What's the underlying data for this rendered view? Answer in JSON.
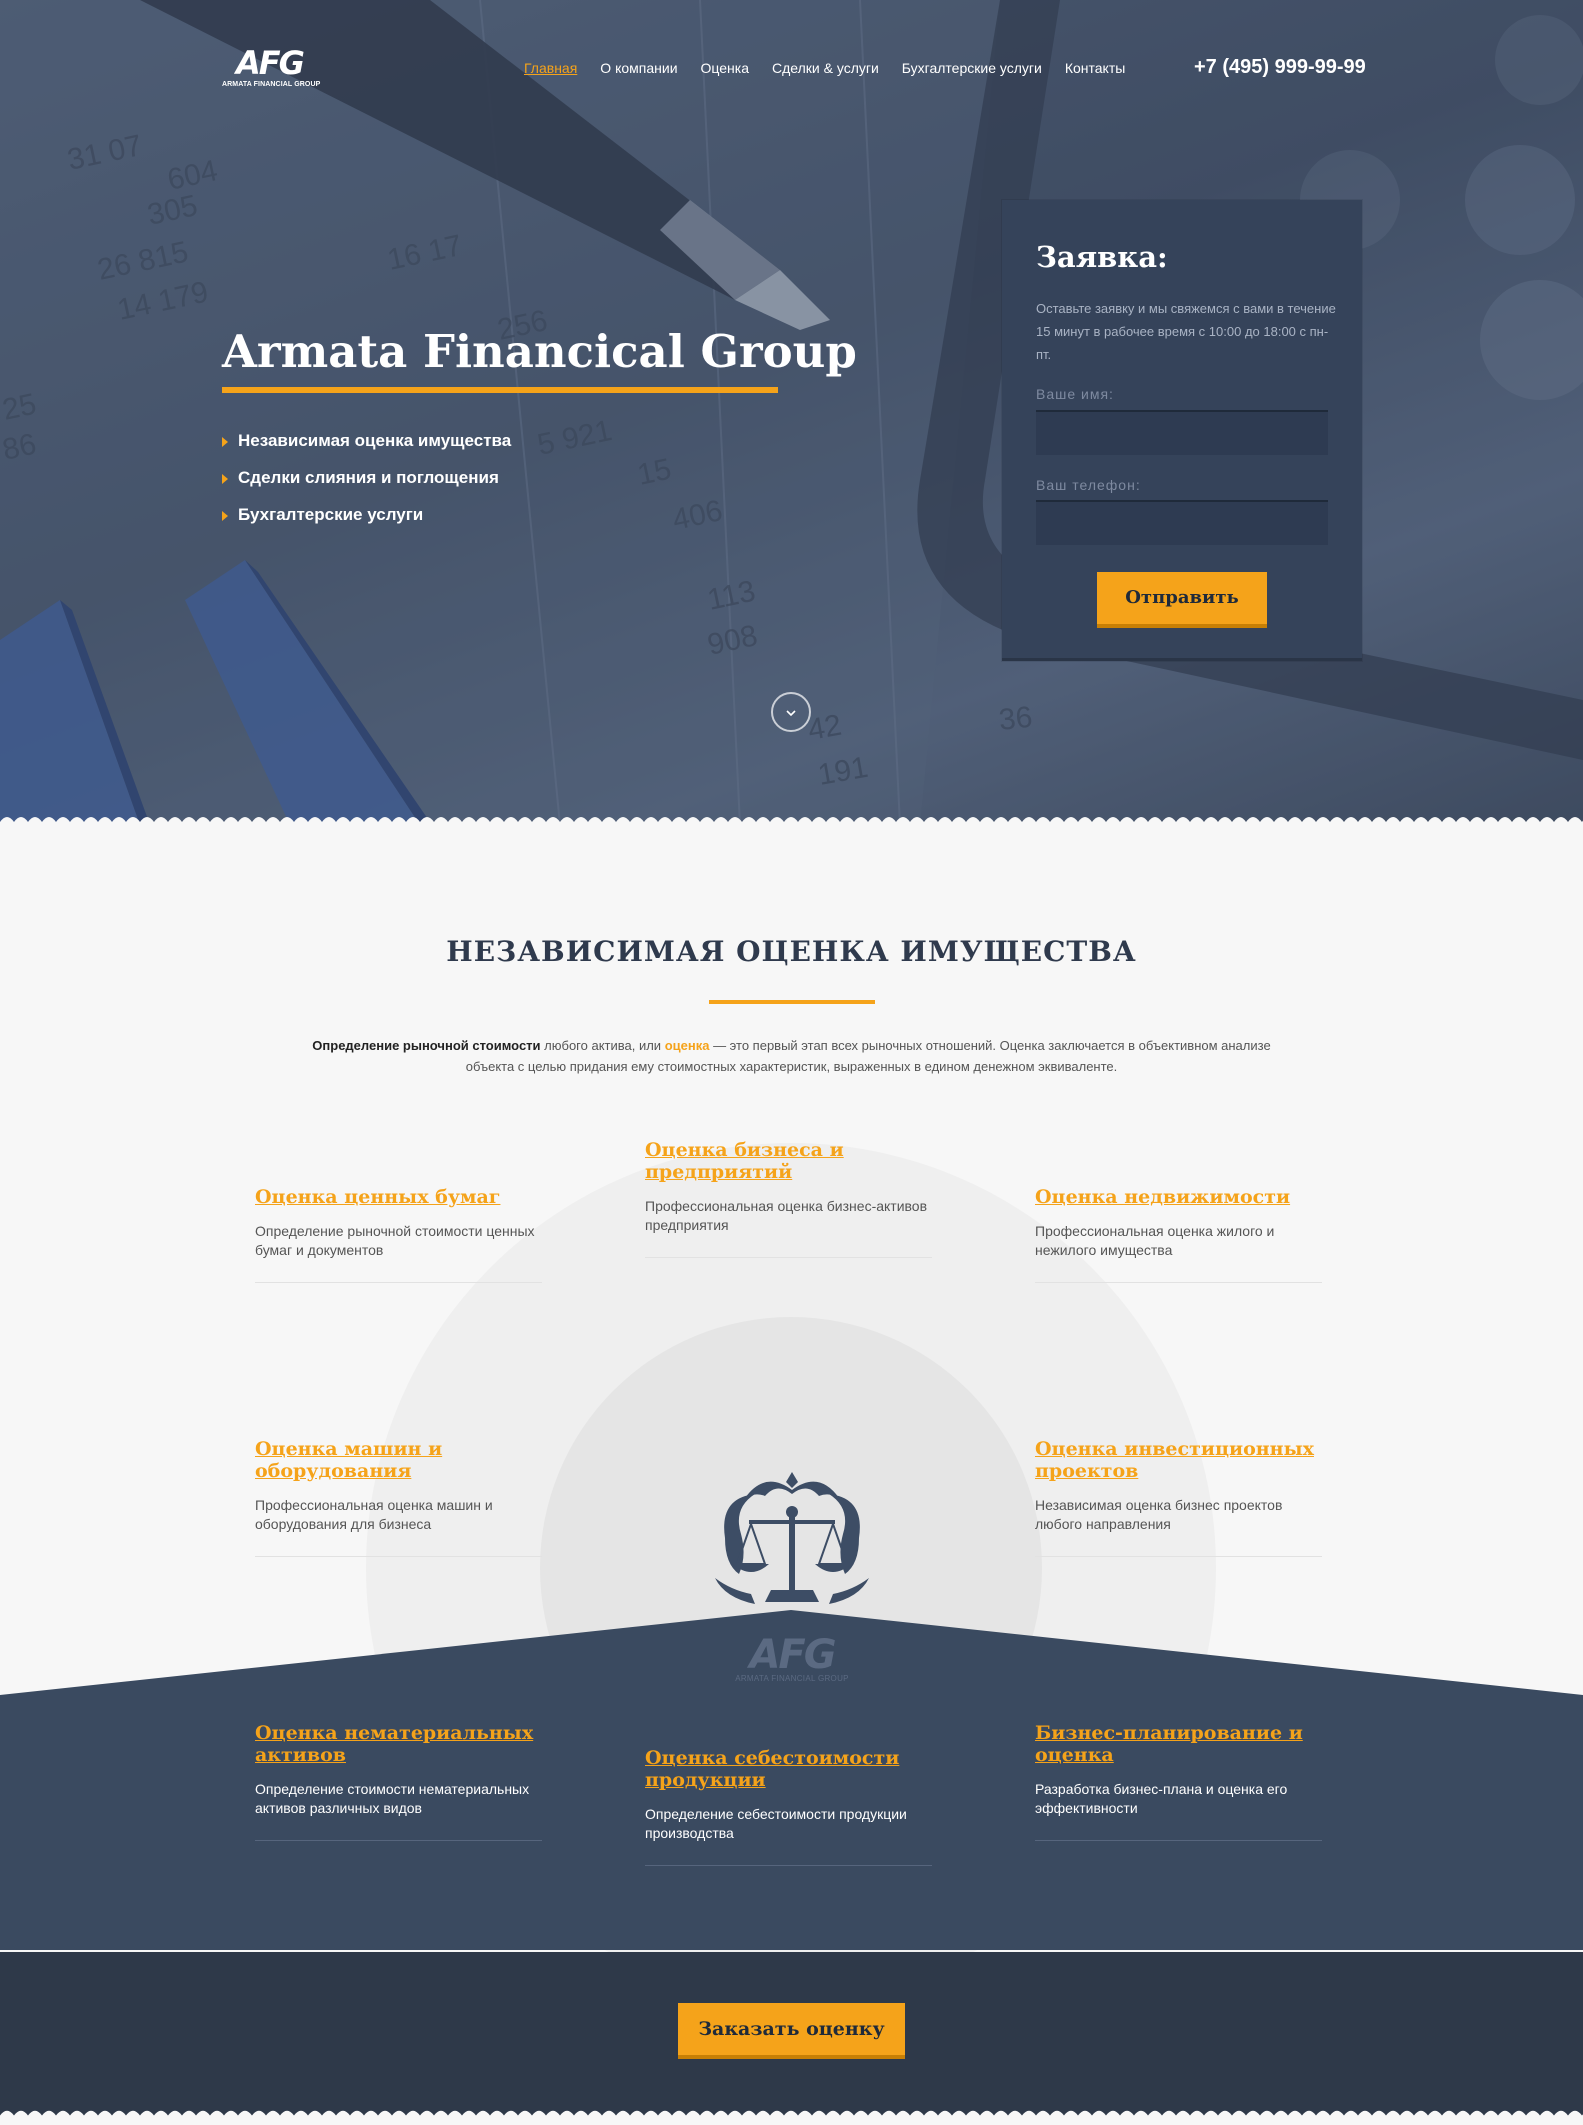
{
  "header": {
    "logo_mark": "AFG",
    "logo_sub": "ARMATA FINANCIAL GROUP",
    "nav": [
      {
        "label": "Главная"
      },
      {
        "label": "О компании"
      },
      {
        "label": "Оценка"
      },
      {
        "label": "Сделки & услуги"
      },
      {
        "label": "Бухгалтерские услуги"
      },
      {
        "label": "Контакты"
      }
    ],
    "phone": "+7 (495) 999-99-99"
  },
  "hero": {
    "title": "Armata Financical Group",
    "bullets": [
      "Независимая оценка имущества",
      "Сделки слияния и поглощения",
      "Бухгалтерские услуги"
    ],
    "scroll_icon": "chevron-down-icon",
    "bg_numbers": [
      "31 07",
      "604",
      "305",
      "26 815",
      "16 17",
      "14 179",
      "256",
      "25",
      "86",
      "5 921",
      "15",
      "406",
      "113",
      "908",
      "36",
      "42",
      "191"
    ]
  },
  "form": {
    "title": "Заявка:",
    "description": "Оставьте заявку и мы свяжемся с вами в течение 15 минут в рабочее время с 10:00 до 18:00 с пн-пт.",
    "name_label": "Ваше имя:",
    "phone_label": "Ваш телефон:",
    "name_value": "",
    "phone_value": "",
    "submit": "Отправить"
  },
  "section": {
    "title": "НЕЗАВИСИМАЯ ОЦЕНКА ИМУЩЕСТВА",
    "desc_bold": "Определение рыночной стоимости",
    "desc_part1": " любого актива, или ",
    "desc_highlight": "оценка",
    "desc_part2": " — это первый этап всех рыночных отношений. Оценка заключается в объективном анализе объекта с целью придания ему стоимостных характеристик, выраженных в едином денежном эквиваленте.",
    "emblem_logo": "AFG",
    "emblem_sub": "ARMATA FINANCIAL GROUP"
  },
  "services": [
    {
      "title": "Оценка ценных бумаг",
      "text": "Определение рыночной стоимости ценных бумаг и документов"
    },
    {
      "title": "Оценка бизнеса и предприятий",
      "text": "Профессиональная оценка бизнес-активов предприятия"
    },
    {
      "title": "Оценка недвижимости",
      "text": "Профессиональная оценка жилого и нежилого имущества"
    },
    {
      "title": "Оценка машин и оборудования",
      "text": "Профессиональная оценка машин и оборудования для бизнеса"
    },
    {
      "title": "Оценка инвестиционных проектов",
      "text": "Независимая оценка бизнес проектов любого направления"
    },
    {
      "title": "Оценка нематериальных активов",
      "text": "Определение стоимости нематериальных активов различных видов"
    },
    {
      "title": "Оценка себестоимости продукции",
      "text": "Определение себестоимости продукции производства"
    },
    {
      "title": "Бизнес-планирование и оценка",
      "text": "Разработка бизнес-плана и оценка его эффективности"
    }
  ],
  "cta": {
    "button": "Заказать оценку"
  },
  "colors": {
    "accent": "#f5a31a",
    "dark": "#3a4a60",
    "darker": "#2e3949",
    "light_bg": "#f7f7f7"
  }
}
